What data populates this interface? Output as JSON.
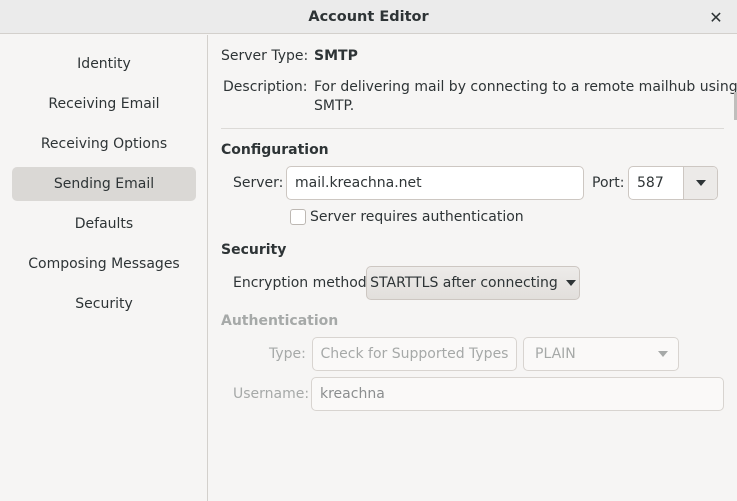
{
  "window": {
    "title": "Account Editor",
    "close_glyph": "✕"
  },
  "sidebar": {
    "items": [
      {
        "label": "Identity"
      },
      {
        "label": "Receiving Email"
      },
      {
        "label": "Receiving Options"
      },
      {
        "label": "Sending Email",
        "active": true
      },
      {
        "label": "Defaults"
      },
      {
        "label": "Composing Messages"
      },
      {
        "label": "Security"
      }
    ]
  },
  "server_info": {
    "type_label": "Server Type:",
    "type_value": "SMTP",
    "description_label": "Description:",
    "description_line1": "For delivering mail by connecting to a remote mailhub using",
    "description_line2": "SMTP."
  },
  "configuration": {
    "heading": "Configuration",
    "server_label": "Server:",
    "server_value": "mail.kreachna.net",
    "port_label": "Port:",
    "port_value": "587",
    "auth_checkbox_label": "Server requires authentication",
    "auth_checked": false
  },
  "security": {
    "heading": "Security",
    "encryption_label": "Encryption method:",
    "encryption_value": "STARTTLS after connecting"
  },
  "authentication": {
    "heading": "Authentication",
    "type_label": "Type:",
    "check_types_button": "Check for Supported Types",
    "type_value": "PLAIN",
    "username_label": "Username:",
    "username_value": "kreachna"
  },
  "colors": {
    "accent_selected": "#dad8d5",
    "background": "#f6f5f4",
    "disabled_text": "#a6a9a8"
  },
  "icons": {
    "close": "close-icon",
    "dropdown": "chevron-down-icon"
  }
}
